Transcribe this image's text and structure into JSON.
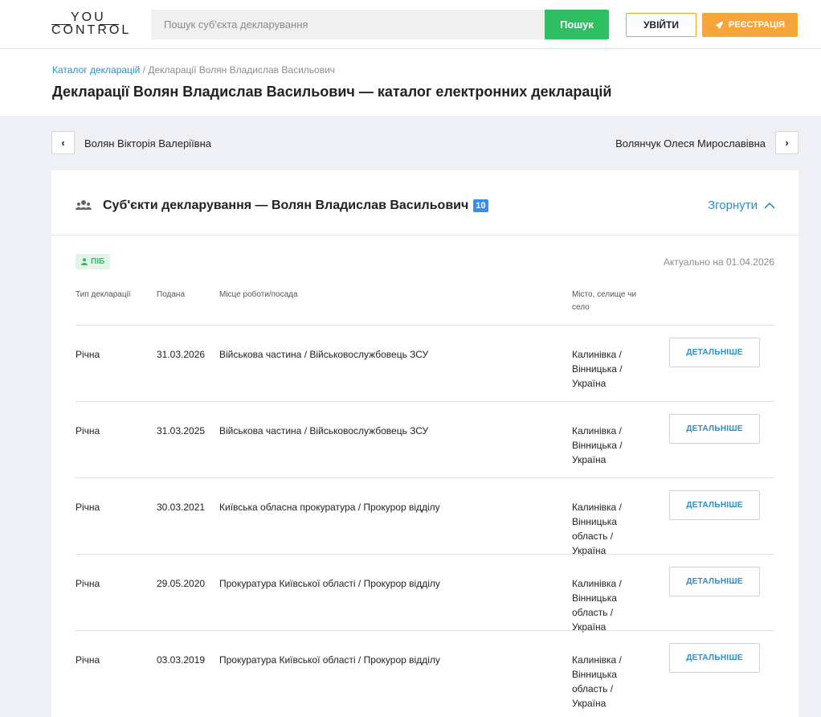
{
  "header": {
    "logo_top": "YOU",
    "logo_bottom": "CONTROL",
    "search_placeholder": "Пошук суб'єкта декларування",
    "search_button": "Пошук",
    "login_button": "УВІЙТИ",
    "register_button": "РЕЄСТРАЦІЯ"
  },
  "breadcrumb": {
    "link": "Каталог декларацій",
    "separator": "/",
    "current": "Декларації Волян Владислав Васильович"
  },
  "page_title": "Декларації Волян Владислав Васильович — каталог електронних декларацій",
  "navigation": {
    "prev_name": "Волян Вікторія Валеріївна",
    "next_name": "Волянчук Олеся Мирославівна",
    "prev_glyph": "‹",
    "next_glyph": "›"
  },
  "card": {
    "title": "Суб'єкти декларування — Волян Владислав Васильович",
    "count": "10",
    "collapse_label": "Згорнути",
    "tag": "ПІБ",
    "actual_date": "Актуально на 01.04.2026",
    "columns": {
      "type": "Тип декларації",
      "date": "Подана",
      "work": "Місце роботи/посада",
      "city": "Місто, селище чи село"
    },
    "rows": [
      {
        "type": "Річна",
        "date": "31.03.2026",
        "work": "Військова частина / Військовослужбовець ЗСУ",
        "city": "Калинівка / Вінницька / Україна",
        "button": "ДЕТАЛЬНІШЕ"
      },
      {
        "type": "Річна",
        "date": "31.03.2025",
        "work": "Військова частина / Військовослужбовець ЗСУ",
        "city": "Калинівка / Вінницька / Україна",
        "button": "ДЕТАЛЬНІШЕ"
      },
      {
        "type": "Річна",
        "date": "30.03.2021",
        "work": "Київська обласна прокуратура / Прокурор відділу",
        "city": "Калинівка / Вінницька область / Україна",
        "button": "ДЕТАЛЬНІШЕ"
      },
      {
        "type": "Річна",
        "date": "29.05.2020",
        "work": "Прокуратура Київської області / Прокурор відділу",
        "city": "Калинівка / Вінницька область / Україна",
        "button": "ДЕТАЛЬНІШЕ"
      },
      {
        "type": "Річна",
        "date": "03.03.2019",
        "work": "Прокуратура Київської області / Прокурор відділу",
        "city": "Калинівка / Вінницька область / Україна",
        "button": "ДЕТАЛЬНІШЕ"
      }
    ]
  },
  "colors": {
    "accent_green": "#2ebf63",
    "accent_orange": "#f5a53a",
    "link_blue": "#2c8ec5",
    "badge_blue": "#3a8ee6"
  }
}
